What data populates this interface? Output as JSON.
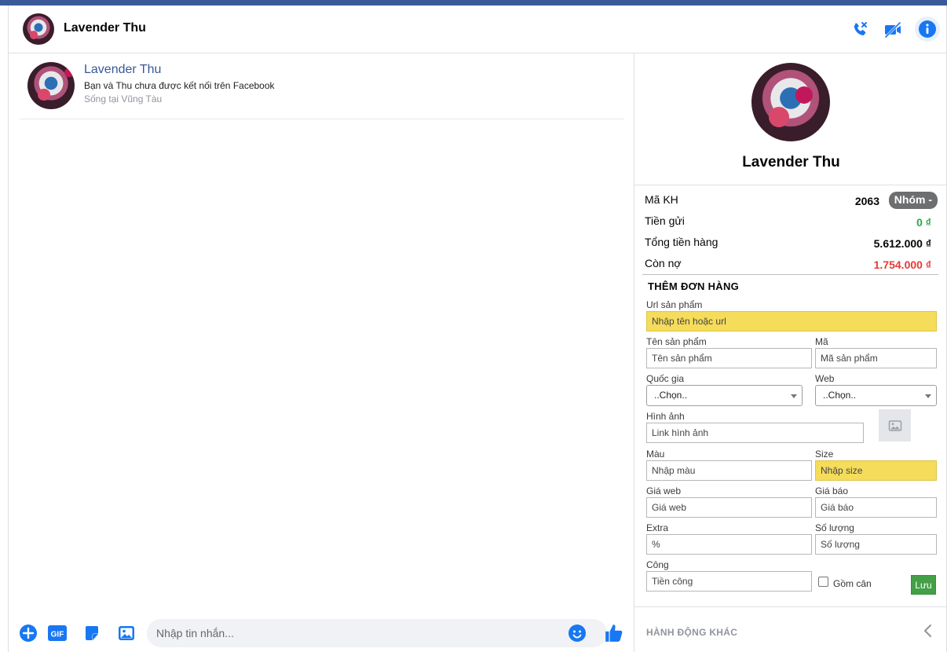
{
  "header": {
    "name": "Lavender Thu"
  },
  "chat": {
    "profile": {
      "name": "Lavender Thu",
      "connection": "Bạn và Thu chưa được kết nối trên Facebook",
      "location": "Sống tại Vũng Tàu"
    },
    "composer": {
      "placeholder": "Nhập tin nhắn...",
      "icons": [
        "plus-icon",
        "gif-icon",
        "sticker-icon",
        "image-icon",
        "emoji-icon",
        "like-icon"
      ]
    }
  },
  "sidebar": {
    "name": "Lavender Thu",
    "customer": {
      "code_label": "Mã KH",
      "code": "2063",
      "group_badge": "Nhóm -",
      "deposit_label": "Tiền gửi",
      "deposit": "0 ₫",
      "total_label": "Tổng tiền hàng",
      "total": "5.612.000 ₫",
      "debt_label": "Còn nợ",
      "debt": "1.754.000 ₫"
    },
    "order_form": {
      "title": "THÊM ĐƠN HÀNG",
      "url_label": "Url sản phẩm",
      "url_placeholder": "Nhập tên hoặc url",
      "product_name_label": "Tên sản phẩm",
      "product_name_placeholder": "Tên sản phẩm",
      "code_label": "Mã",
      "code_placeholder": "Mã sản phẩm",
      "country_label": "Quốc gia",
      "country_value": "..Chọn..",
      "web_label": "Web",
      "web_value": "..Chọn..",
      "image_label": "Hình ảnh",
      "image_placeholder": "Link hình ảnh",
      "color_label": "Màu",
      "color_placeholder": "Nhập màu",
      "size_label": "Size",
      "size_placeholder": "Nhập size",
      "web_price_label": "Giá web",
      "web_price_placeholder": "Giá web",
      "quoted_price_label": "Giá báo",
      "quoted_price_placeholder": "Giá báo",
      "extra_label": "Extra",
      "extra_placeholder": "%",
      "quantity_label": "Số lượng",
      "quantity_placeholder": "Số lượng",
      "labor_label": "Công",
      "labor_placeholder": "Tiền công",
      "include_weight_label": "Gồm cân",
      "save_label": "Lưu"
    },
    "more_actions": "HÀNH ĐỘNG KHÁC"
  },
  "colors": {
    "accent": "#1877f2",
    "green": "#27a844",
    "red": "#e53935",
    "highlight": "#f5dc5a"
  }
}
